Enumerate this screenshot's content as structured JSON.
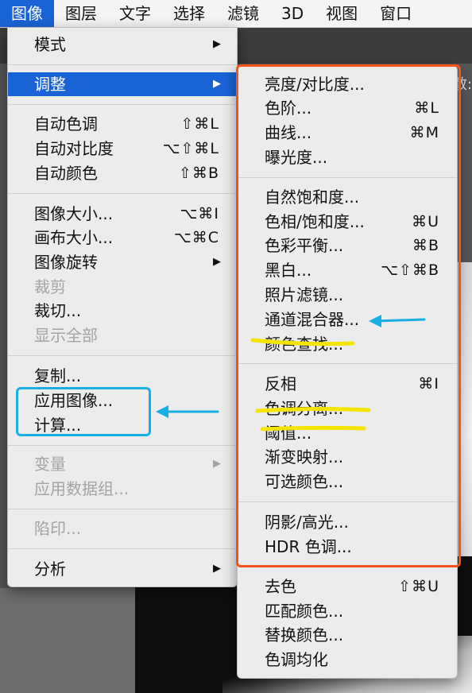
{
  "menubar": {
    "items": [
      "图像",
      "图层",
      "文字",
      "选择",
      "滤镜",
      "3D",
      "视图",
      "窗口"
    ]
  },
  "options_bar": {
    "partial_text": "散:"
  },
  "image_menu": {
    "items": [
      {
        "label": "模式",
        "shortcut": "",
        "submenu": true,
        "disabled": false
      },
      {
        "label": "调整",
        "shortcut": "",
        "submenu": true,
        "disabled": false,
        "highlighted": true
      },
      {
        "label": "自动色调",
        "shortcut": "⇧⌘L",
        "disabled": false
      },
      {
        "label": "自动对比度",
        "shortcut": "⌥⇧⌘L",
        "disabled": false
      },
      {
        "label": "自动颜色",
        "shortcut": "⇧⌘B",
        "disabled": false
      },
      {
        "label": "图像大小...",
        "shortcut": "⌥⌘I",
        "disabled": false
      },
      {
        "label": "画布大小...",
        "shortcut": "⌥⌘C",
        "disabled": false
      },
      {
        "label": "图像旋转",
        "shortcut": "",
        "submenu": true,
        "disabled": false
      },
      {
        "label": "裁剪",
        "shortcut": "",
        "disabled": true
      },
      {
        "label": "裁切...",
        "shortcut": "",
        "disabled": false
      },
      {
        "label": "显示全部",
        "shortcut": "",
        "disabled": true
      },
      {
        "label": "复制...",
        "shortcut": "",
        "disabled": false
      },
      {
        "label": "应用图像...",
        "shortcut": "",
        "disabled": false
      },
      {
        "label": "计算...",
        "shortcut": "",
        "disabled": false
      },
      {
        "label": "变量",
        "shortcut": "",
        "submenu": true,
        "disabled": true
      },
      {
        "label": "应用数据组...",
        "shortcut": "",
        "disabled": true
      },
      {
        "label": "陷印...",
        "shortcut": "",
        "disabled": true
      },
      {
        "label": "分析",
        "shortcut": "",
        "submenu": true,
        "disabled": false
      }
    ]
  },
  "adjust_menu": {
    "items": [
      {
        "label": "亮度/对比度...",
        "shortcut": ""
      },
      {
        "label": "色阶...",
        "shortcut": "⌘L"
      },
      {
        "label": "曲线...",
        "shortcut": "⌘M"
      },
      {
        "label": "曝光度...",
        "shortcut": ""
      },
      {
        "label": "自然饱和度...",
        "shortcut": ""
      },
      {
        "label": "色相/饱和度...",
        "shortcut": "⌘U"
      },
      {
        "label": "色彩平衡...",
        "shortcut": "⌘B"
      },
      {
        "label": "黑白...",
        "shortcut": "⌥⇧⌘B"
      },
      {
        "label": "照片滤镜...",
        "shortcut": ""
      },
      {
        "label": "通道混合器...",
        "shortcut": ""
      },
      {
        "label": "颜色查找...",
        "shortcut": ""
      },
      {
        "label": "反相",
        "shortcut": "⌘I"
      },
      {
        "label": "色调分离...",
        "shortcut": ""
      },
      {
        "label": "阈值...",
        "shortcut": ""
      },
      {
        "label": "渐变映射...",
        "shortcut": ""
      },
      {
        "label": "可选颜色...",
        "shortcut": ""
      },
      {
        "label": "阴影/高光...",
        "shortcut": ""
      },
      {
        "label": "HDR 色调...",
        "shortcut": ""
      },
      {
        "label": "去色",
        "shortcut": "⇧⌘U"
      },
      {
        "label": "匹配颜色...",
        "shortcut": ""
      },
      {
        "label": "替换颜色...",
        "shortcut": ""
      },
      {
        "label": "色调均化",
        "shortcut": ""
      }
    ]
  },
  "icons": {
    "submenu_arrow": "▶"
  },
  "colors": {
    "highlight": "#1a63d6",
    "annotation_orange": "#f2541b",
    "annotation_cyan": "#18aee6",
    "annotation_yellow": "#f5e400",
    "disabled_text": "#a3a3a3"
  }
}
